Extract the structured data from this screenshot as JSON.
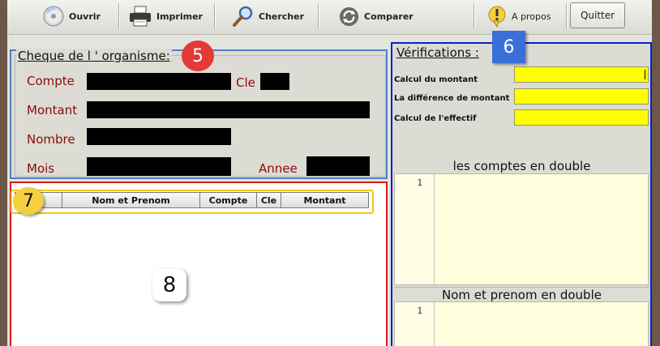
{
  "toolbar": {
    "open_label": "Ouvrir",
    "print_label": "Imprimer",
    "search_label": "Chercher",
    "compare_label": "Comparer",
    "about_label": "A propos",
    "quit_label": "Quitter"
  },
  "cheque": {
    "title": "Cheque de l ' organisme:",
    "compte_label": "Compte",
    "cle_label": "Cle",
    "montant_label": "Montant",
    "nombre_label": "Nombre",
    "mois_label": "Mois",
    "annee_label": "Annee"
  },
  "table": {
    "columns": [
      "",
      "Nom et Prenom",
      "Compte",
      "Cle",
      "Montant"
    ]
  },
  "verifications": {
    "title": "Vérifications :",
    "calc_montant_label": "Calcul du montant",
    "diff_montant_label": "La différence de montant",
    "calc_effectif_label": "Calcul de l'effectif",
    "comptes_double_title": "les comptes en double",
    "comptes_double_line": "1",
    "nom_double_title": "Nom et prenom en double",
    "nom_double_line": "1"
  },
  "callouts": {
    "c5": "5",
    "c6": "6",
    "c7": "7",
    "c8": "8"
  },
  "colors": {
    "label_red": "#8b0a0a",
    "panel5_border": "#4f7fc8",
    "panel6_border": "#0a1fc8",
    "panel8_border": "#e01818",
    "highlight_yellow": "#ffff00",
    "badge_red": "#e53935",
    "badge_blue": "#3b6fd8",
    "badge_yellow": "#f4d03f"
  }
}
